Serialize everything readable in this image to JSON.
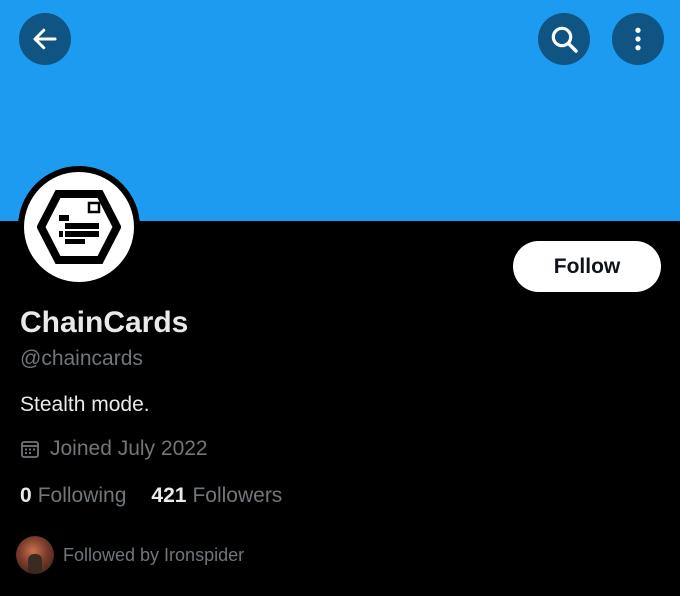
{
  "profile": {
    "display_name": "ChainCards",
    "handle": "@chaincards",
    "bio": "Stealth mode.",
    "joined": "Joined July 2022",
    "following_count": "0",
    "following_label": "Following",
    "followers_count": "421",
    "followers_label": "Followers",
    "followed_by": "Followed by Ironspider"
  },
  "actions": {
    "follow_label": "Follow"
  },
  "icons": {
    "back": "arrow-left-icon",
    "search": "search-icon",
    "more": "more-vertical-icon",
    "calendar": "calendar-icon"
  },
  "colors": {
    "banner": "#1d9bf0",
    "background": "#000000",
    "primary_text": "#e7e9ea",
    "secondary_text": "#71767b",
    "header_button": "#0f5483",
    "follow_button_bg": "#ffffff"
  }
}
